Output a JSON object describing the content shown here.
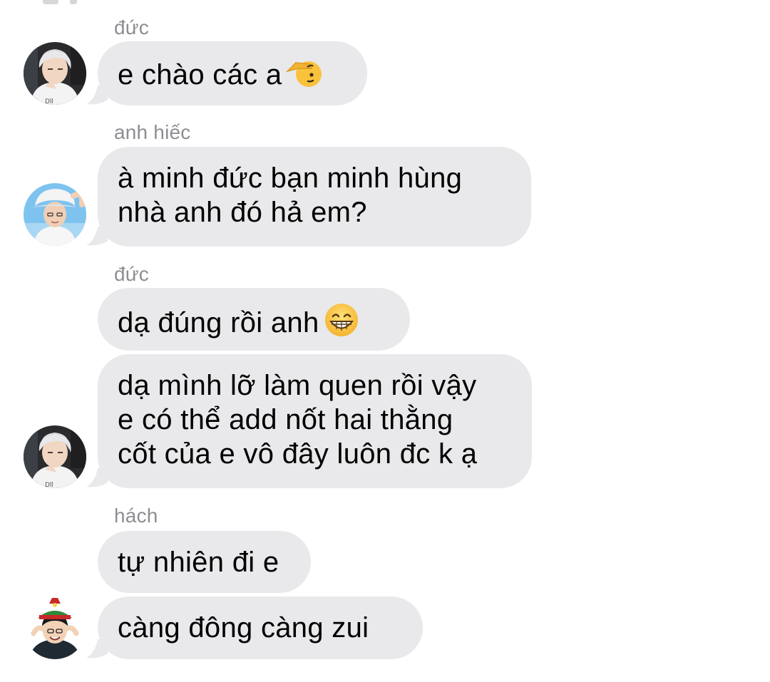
{
  "chat": {
    "messages": [
      {
        "sender": "đức",
        "lines": [
          "e chào các a"
        ],
        "emoji": "saluting-face-icon"
      },
      {
        "sender": "anh hiếc",
        "lines": [
          "à minh đức bạn minh hùng",
          "nhà anh đó hả em?"
        ]
      },
      {
        "sender": "đức",
        "lines": [
          "dạ đúng rồi anh"
        ],
        "emoji": "grinning-face-icon"
      },
      {
        "lines": [
          "dạ mình lỡ làm quen rồi vậy",
          "e có thể add nốt hai thằng",
          "cốt của e vô đây luôn đc k ạ"
        ]
      },
      {
        "sender": "hách",
        "lines": [
          "tự nhiên đi e"
        ]
      },
      {
        "lines": [
          "càng đông càng zui"
        ]
      }
    ]
  },
  "colors": {
    "bubble": "#e9e9eb",
    "sender_label": "#8e8e93",
    "text": "#000000",
    "background": "#ffffff"
  }
}
